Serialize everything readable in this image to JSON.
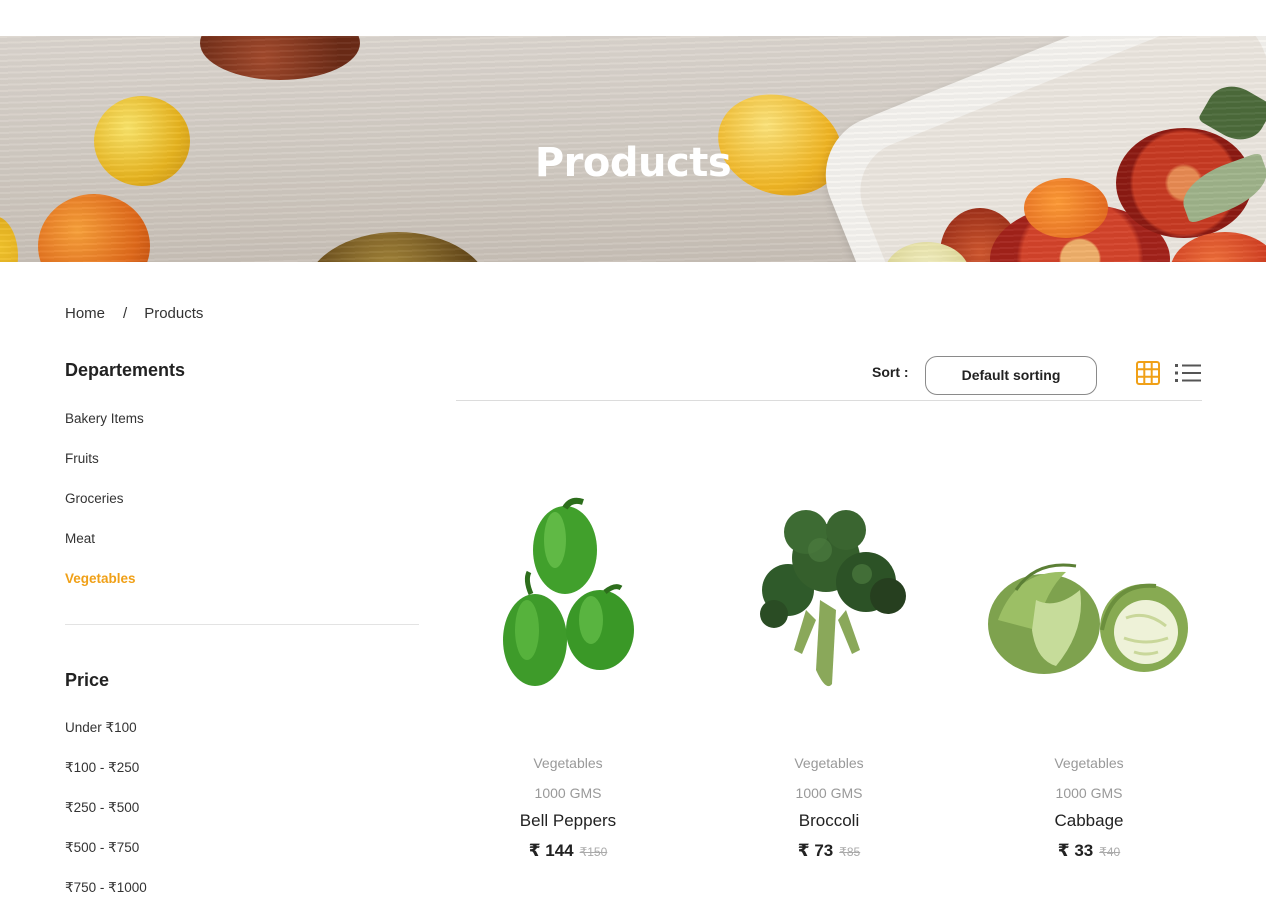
{
  "hero": {
    "title": "Products"
  },
  "breadcrumb": {
    "home": "Home",
    "separator": "/",
    "current": "Products"
  },
  "sidebar": {
    "departments_heading": "Departements",
    "departments": [
      {
        "label": "Bakery Items",
        "active": false
      },
      {
        "label": "Fruits",
        "active": false
      },
      {
        "label": "Groceries",
        "active": false
      },
      {
        "label": "Meat",
        "active": false
      },
      {
        "label": "Vegetables",
        "active": true
      }
    ],
    "price_heading": "Price",
    "price_ranges": [
      "Under ₹100",
      "₹100 - ₹250",
      "₹250 - ₹500",
      "₹500 - ₹750",
      "₹750 - ₹1000"
    ]
  },
  "toolbar": {
    "sort_label": "Sort :",
    "sort_value": "Default sorting",
    "grid_view_icon": "grid-icon",
    "list_view_icon": "list-icon",
    "accent_color": "#f0a017"
  },
  "products": [
    {
      "category": "Vegetables",
      "weight": "1000 GMS",
      "name": "Bell Peppers",
      "price": "₹ 144",
      "old_price": "₹150",
      "image_icon": "bell-pepper-image"
    },
    {
      "category": "Vegetables",
      "weight": "1000 GMS",
      "name": "Broccoli",
      "price": "₹ 73",
      "old_price": "₹85",
      "image_icon": "broccoli-image"
    },
    {
      "category": "Vegetables",
      "weight": "1000 GMS",
      "name": "Cabbage",
      "price": "₹ 33",
      "old_price": "₹40",
      "image_icon": "cabbage-image"
    }
  ]
}
